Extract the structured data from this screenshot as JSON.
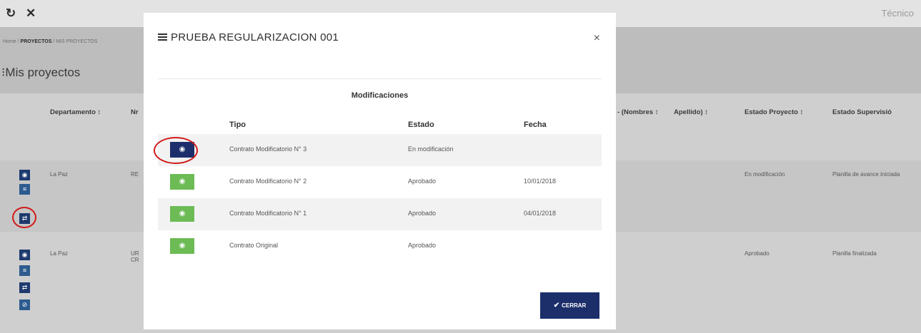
{
  "topbar": {
    "refresh_icon": "↻",
    "tools_icon": "✕",
    "user_label": "Técnico"
  },
  "breadcrumb": {
    "home": "Home",
    "proyectos": "PROYECTOS",
    "mis_proyectos": "MIS PROYECTOS"
  },
  "page": {
    "title": "Mis proyectos",
    "title_icon": "⁝"
  },
  "table": {
    "headers": {
      "departamento": "Departamento ↕",
      "nro": "Nr",
      "nombres": "- (Nombres ↕",
      "apellido": "Apellido) ↕",
      "estado_proyecto": "Estado Proyecto ↕",
      "estado_supervision": "Estado Supervisió"
    },
    "rows": [
      {
        "departamento": "La Paz",
        "nro": "RE",
        "estado_proyecto": "En modificación",
        "estado_supervision": "Planilla de avance iniciada"
      },
      {
        "departamento": "La Paz",
        "nro": "UR CR",
        "estado_proyecto": "Aprobado",
        "estado_supervision": "Planilla finalizada"
      }
    ]
  },
  "modal": {
    "title": "PRUEBA REGULARIZACION 001",
    "close_symbol": "×",
    "section_title": "Modificaciones",
    "columns": {
      "tipo": "Tipo",
      "estado": "Estado",
      "fecha": "Fecha"
    },
    "rows": [
      {
        "tipo": "Contrato Modificatorio N° 3",
        "estado": "En modificación",
        "fecha": "",
        "button_style": "dark"
      },
      {
        "tipo": "Contrato Modificatorio N° 2",
        "estado": "Aprobado",
        "fecha": "10/01/2018",
        "button_style": "green"
      },
      {
        "tipo": "Contrato Modificatorio N° 1",
        "estado": "Aprobado",
        "fecha": "04/01/2018",
        "button_style": "green"
      },
      {
        "tipo": "Contrato Original",
        "estado": "Aprobado",
        "fecha": "",
        "button_style": "green"
      }
    ],
    "view_icon": "eye-icon",
    "close_button_label": "CERRAR",
    "close_button_icon": "✔"
  },
  "colors": {
    "primary_dark": "#1c2f6b",
    "success_green": "#6cbb55",
    "highlight_red": "#d11a1a"
  }
}
